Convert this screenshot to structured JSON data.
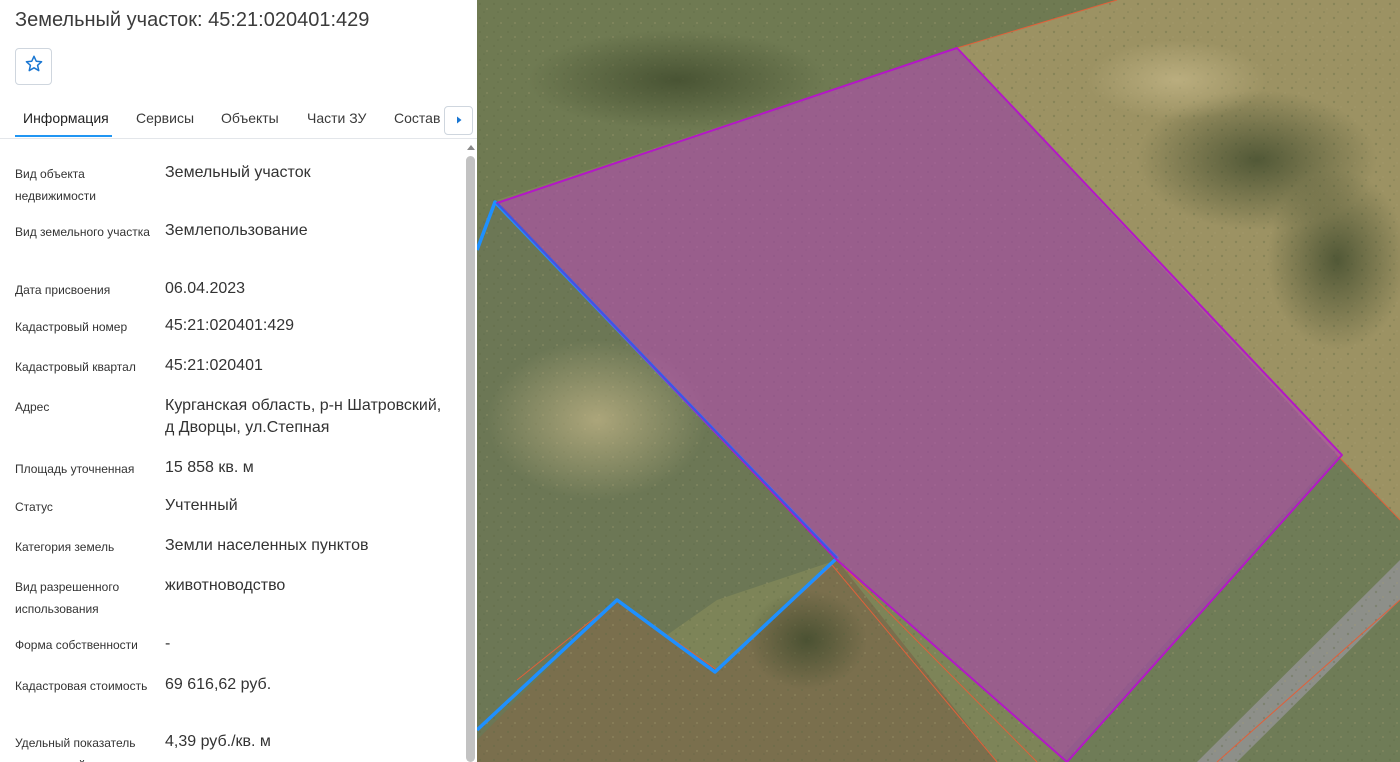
{
  "panel": {
    "title": "Земельный участок: 45:21:020401:429",
    "favorite_icon": "star-outline-icon",
    "tabs": [
      {
        "label": "Информация",
        "active": true
      },
      {
        "label": "Сервисы",
        "active": false
      },
      {
        "label": "Объекты",
        "active": false
      },
      {
        "label": "Части ЗУ",
        "active": false
      },
      {
        "label": "Состав",
        "active": false
      }
    ],
    "tabs_next_icon": "chevron-right-icon",
    "rows": [
      {
        "label": "Вид объекта недвижимости",
        "value": "Земельный участок"
      },
      {
        "label": "Вид земельного участка",
        "value": "Землепользование"
      },
      {
        "label": "Дата присвоения",
        "value": "06.04.2023"
      },
      {
        "label": "Кадастровый номер",
        "value": "45:21:020401:429"
      },
      {
        "label": "Кадастровый квартал",
        "value": "45:21:020401"
      },
      {
        "label": "Адрес",
        "value": "Курганская область, р-н Шатровский, д Дворцы, ул.Степная"
      },
      {
        "label": "Площадь уточненная",
        "value": "15 858 кв. м"
      },
      {
        "label": "Статус",
        "value": "Учтенный"
      },
      {
        "label": "Категория земель",
        "value": "Земли населенных пунктов"
      },
      {
        "label": "Вид разрешенного использования",
        "value": "животноводство"
      },
      {
        "label": "Форма собственности",
        "value": "-"
      },
      {
        "label": "Кадастровая стоимость",
        "value": "69 616,62 руб."
      },
      {
        "label": "Удельный показатель кадастровой стоимости",
        "value": "4,39 руб./кв. м"
      }
    ]
  },
  "colors": {
    "accent": "#2196f3",
    "parcel_fill": "#b040b8",
    "parcel_outline": "#b318c6",
    "boundary_blue": "#1e90ff",
    "boundary_red": "#e0603a"
  }
}
